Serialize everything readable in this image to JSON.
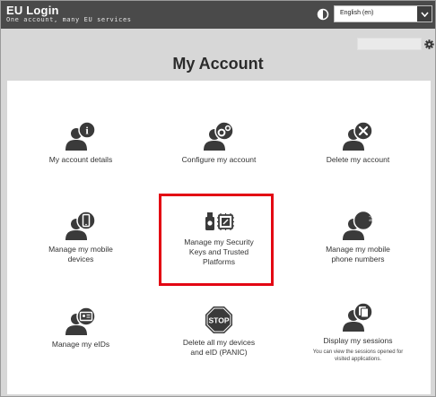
{
  "header": {
    "title": "EU Login",
    "subtitle": "One account, many EU services",
    "language": "English (en)",
    "contrast_icon": "contrast-icon",
    "dropdown_icon": "chevron-down-icon",
    "settings_icon": "gear-icon"
  },
  "page": {
    "title": "My Account"
  },
  "tiles": [
    {
      "label": "My account details",
      "icon": "user-info-icon"
    },
    {
      "label": "Configure my account",
      "icon": "user-gears-icon"
    },
    {
      "label": "Delete my account",
      "icon": "user-delete-icon"
    },
    {
      "label": "Manage my mobile devices",
      "icon": "user-mobile-icon"
    },
    {
      "label": "Manage my Security Keys and Trusted Platforms",
      "icon": "security-key-icon"
    },
    {
      "label": "Manage my mobile phone numbers",
      "icon": "user-phone-number-icon"
    },
    {
      "label": "Manage my eIDs",
      "icon": "user-eid-card-icon"
    },
    {
      "label": "Delete all my devices and eID (PANIC)",
      "icon": "stop-sign-icon",
      "icon_text": "STOP"
    },
    {
      "label": "Display my sessions",
      "icon": "user-sessions-icon",
      "sublabel": "You can view the sessions opened for visited applications."
    }
  ],
  "phone_badge": "+32123 456789",
  "colors": {
    "topbar": "#4a4a4a",
    "background": "#d7d7d7",
    "icon": "#3a3a3a",
    "highlight": "#e30613"
  }
}
